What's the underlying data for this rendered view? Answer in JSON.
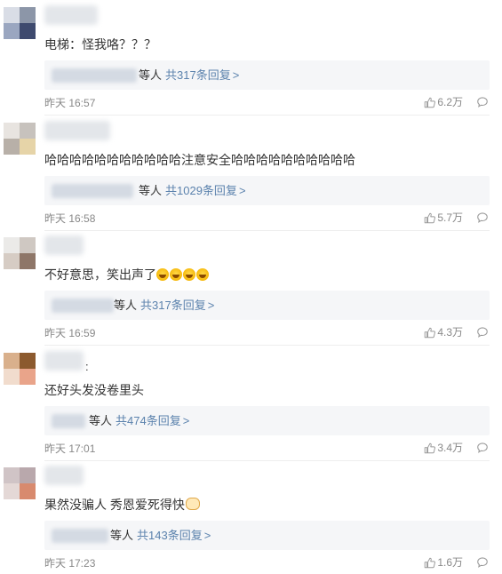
{
  "comments": [
    {
      "text": "电梯：怪我咯？？？",
      "reply_suffix": "等人",
      "reply_count": "共317条回复",
      "reply_chevron": ">",
      "time": "昨天 16:57",
      "likes": "6.2万",
      "like_icon": "thumbs-up-icon",
      "comment_icon": "comment-bubble-icon"
    },
    {
      "text": "哈哈哈哈哈哈哈哈哈哈哈注意安全哈哈哈哈哈哈哈哈哈哈",
      "reply_suffix": "等人",
      "reply_count": "共1029条回复",
      "reply_chevron": ">",
      "time": "昨天 16:58",
      "likes": "5.7万",
      "like_icon": "thumbs-up-icon",
      "comment_icon": "comment-bubble-icon"
    },
    {
      "text": "不好意思，笑出声了",
      "emoji": "laughing-crying-emoji",
      "reply_suffix": "等人",
      "reply_count": "共317条回复",
      "reply_chevron": ">",
      "time": "昨天 16:59",
      "likes": "4.3万",
      "like_icon": "thumbs-up-icon",
      "comment_icon": "comment-bubble-icon"
    },
    {
      "author_suffix": ":",
      "text": "还好头发没卷里头",
      "reply_suffix": "等人",
      "reply_count": "共474条回复",
      "reply_chevron": ">",
      "time": "昨天 17:01",
      "likes": "3.4万",
      "like_icon": "thumbs-up-icon",
      "comment_icon": "comment-bubble-icon"
    },
    {
      "text": "果然没骗人 秀恩爱死得快",
      "emoji": "cat-face-emoji",
      "reply_suffix": "等人",
      "reply_count": "共143条回复",
      "reply_chevron": ">",
      "time": "昨天 17:23",
      "likes": "1.6万",
      "like_icon": "thumbs-up-icon",
      "comment_icon": "comment-bubble-icon"
    }
  ],
  "colors": {
    "link": "#5b82ad",
    "meta": "#888888",
    "text": "#333333",
    "reply_bg": "#f5f6f8",
    "divider": "#eeeeee"
  }
}
